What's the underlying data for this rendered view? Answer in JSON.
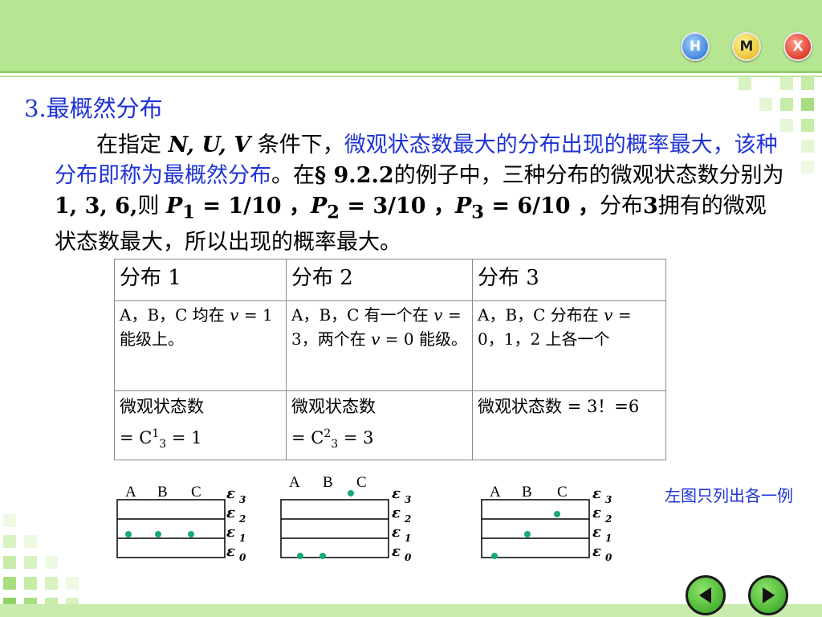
{
  "nav": {
    "home": "H",
    "menu": "M",
    "exit": "X"
  },
  "heading": "3.最概然分布",
  "paragraph": {
    "t1": "在指定 ",
    "vars": "N, U, V",
    "t2": " 条件下，",
    "highlight": "微观状态数最大的分布出现的概率最大，该种分布即称为最概然分布",
    "t3": "。在",
    "section": "§ 9.2.2",
    "t4": "的例子中，三种分布的微观状态数分别为",
    "counts": "1, 3, 6,",
    "t5": "则 ",
    "p1": "P",
    "p1sub": "1",
    "p1val": " = 1/10 ，",
    "p2": "P",
    "p2sub": "2",
    "p2val": " = 3/10 ，",
    "p3": "P",
    "p3sub": "3",
    "p3val": " = 6/10 ，",
    "t6": "分布",
    "three": "3",
    "t7": "拥有的微观状态数最大，所以出现的概率最大。"
  },
  "table": {
    "headers": [
      "分布 1",
      "分布 2",
      "分布 3"
    ],
    "row2": {
      "c1a": "A，B，C 均在 ",
      "c1v": "v",
      "c1b": " = 1 能级上。",
      "c2a": "A，B，C 有一个在 ",
      "c2v1": "v",
      "c2b": " = 3，两个在 ",
      "c2v2": "v",
      "c2c": " = 0 能级。",
      "c3a": "A，B，C 分布在 ",
      "c3v": "v",
      "c3b": " = 0，1，2 上各一个"
    },
    "row3": {
      "label": "微观状态数",
      "c1pre": " = ",
      "c1comb": "C",
      "c1sup": "1",
      "c1sub": "3",
      "c1post": " = 1",
      "c2pre": " = ",
      "c2comb": "C",
      "c2sup": "2",
      "c2sub": "3",
      "c2post": " = 3",
      "c3": "微观状态数 = 3！=6"
    }
  },
  "diagrams": {
    "particles": [
      "A",
      "B",
      "C"
    ],
    "levels": [
      "ε3",
      "ε2",
      "ε1",
      "ε0"
    ],
    "eps": "ε",
    "subs": [
      "3",
      "2",
      "1",
      "0"
    ]
  },
  "note": "左图只列出各一例",
  "colors": {
    "accent": "#1f33d6",
    "band": "#b7e692",
    "dot": "#18a878"
  }
}
